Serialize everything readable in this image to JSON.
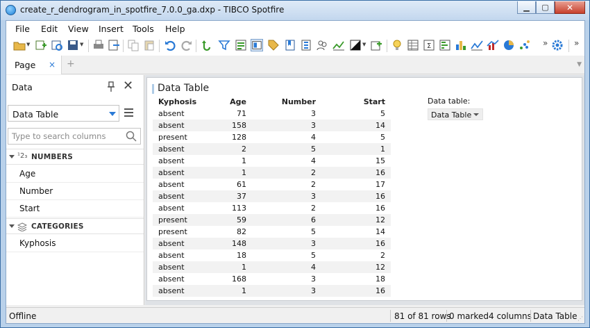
{
  "window": {
    "title": "create_r_dendrogram_in_spotfire_7.0.0_ga.dxp - TIBCO Spotfire"
  },
  "menu": [
    "File",
    "Edit",
    "View",
    "Insert",
    "Tools",
    "Help"
  ],
  "toolbar": {
    "icons": [
      "open-folder-icon",
      "add-data-icon",
      "reload-icon",
      "save-icon",
      "print-icon",
      "export-icon",
      "copy-icon",
      "paste-icon",
      "undo-icon",
      "redo-icon",
      "reset-filters-icon",
      "filter-icon",
      "details-on-demand-icon",
      "layout-icon",
      "tags-icon",
      "bookmark-icon",
      "lists-icon",
      "people-icon",
      "line-similarity-icon",
      "color-icon",
      "add-page-icon",
      "tip-icon",
      "table-icon",
      "crosstable-icon",
      "graphical-table-icon",
      "bar-chart-icon",
      "line-chart-icon",
      "combination-chart-icon",
      "pie-chart-icon",
      "scatter-plot-icon",
      "settings-gear-icon"
    ],
    "overflow_glyph": "»"
  },
  "tabs": {
    "page_label": "Page",
    "close_glyph": "×",
    "add_glyph": "+"
  },
  "data_panel": {
    "title": "Data",
    "datatable_value": "Data Table",
    "search_placeholder": "Type to search columns",
    "sections": [
      {
        "label": "NUMBERS",
        "icon": "¹2₃",
        "items": [
          "Age",
          "Number",
          "Start"
        ]
      },
      {
        "label": "CATEGORIES",
        "icon": "layers-icon",
        "items": [
          "Kyphosis"
        ]
      }
    ]
  },
  "visualization": {
    "title": "Data Table",
    "columns": [
      "Kyphosis",
      "Age",
      "Number",
      "Start"
    ],
    "rows": [
      [
        "absent",
        "71",
        "3",
        "5"
      ],
      [
        "absent",
        "158",
        "3",
        "14"
      ],
      [
        "present",
        "128",
        "4",
        "5"
      ],
      [
        "absent",
        "2",
        "5",
        "1"
      ],
      [
        "absent",
        "1",
        "4",
        "15"
      ],
      [
        "absent",
        "1",
        "2",
        "16"
      ],
      [
        "absent",
        "61",
        "2",
        "17"
      ],
      [
        "absent",
        "37",
        "3",
        "16"
      ],
      [
        "absent",
        "113",
        "2",
        "16"
      ],
      [
        "present",
        "59",
        "6",
        "12"
      ],
      [
        "present",
        "82",
        "5",
        "14"
      ],
      [
        "absent",
        "148",
        "3",
        "16"
      ],
      [
        "absent",
        "18",
        "5",
        "2"
      ],
      [
        "absent",
        "1",
        "4",
        "12"
      ],
      [
        "absent",
        "168",
        "3",
        "18"
      ],
      [
        "absent",
        "1",
        "3",
        "16"
      ]
    ],
    "datatable_label": "Data table:",
    "datatable_value": "Data Table"
  },
  "status": {
    "offline": "Offline",
    "rows": "81 of 81 rows",
    "marked": "0 marked",
    "columns": "4 columns",
    "table": "Data Table"
  },
  "colors": {
    "accent": "#2a7ad6",
    "title_bar": "#c3d7ee",
    "close_button": "#c7402c"
  }
}
